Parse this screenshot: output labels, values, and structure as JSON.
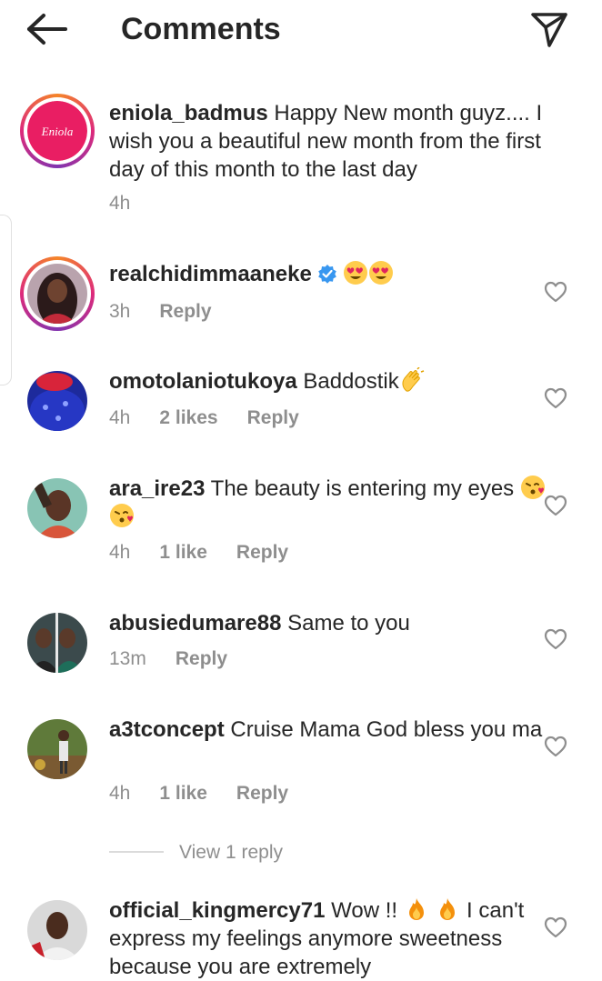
{
  "header": {
    "title": "Comments"
  },
  "comments": [
    {
      "username": "eniola_badmus",
      "text": "Happy New month guyz.... I wish you a beautiful new month from the first day of this month to the last day",
      "time": "4h",
      "likes": "",
      "reply": ""
    },
    {
      "username": "realchidimmaaneke",
      "text": "",
      "time": "3h",
      "likes": "",
      "reply": "Reply"
    },
    {
      "username": "omotolaniotukoya",
      "text": "Baddostik",
      "time": "4h",
      "likes": "2 likes",
      "reply": "Reply"
    },
    {
      "username": "ara_ire23",
      "text": "The beauty is entering my eyes",
      "time": "4h",
      "likes": "1 like",
      "reply": "Reply"
    },
    {
      "username": "abusiedumare88",
      "text": "Same to you",
      "time": "13m",
      "likes": "",
      "reply": "Reply"
    },
    {
      "username": "a3tconcept",
      "text": "Cruise Mama God bless you ma",
      "time": "4h",
      "likes": "1 like",
      "reply": "Reply"
    },
    {
      "username": "official_kingmercy71",
      "text_a": "Wow !!",
      "text_b": "I can't express my feelings anymore sweetness because you are extremely",
      "time": "",
      "likes": "",
      "reply": ""
    }
  ],
  "view_replies": "View 1 reply",
  "avatar_logo_text": "Eniola",
  "icons": {
    "back": "arrow-left-icon",
    "send": "paper-plane-icon",
    "like": "heart-outline-icon",
    "verified": "verified-badge-icon",
    "heart_eyes": "heart-eyes-emoji",
    "clap": "clapping-hands-emoji",
    "kiss": "kissing-heart-emoji",
    "fire": "fire-emoji"
  },
  "colors": {
    "text": "#262626",
    "muted": "#8e8e8e",
    "verified": "#3897f0",
    "brand_pink": "#e91e63"
  }
}
